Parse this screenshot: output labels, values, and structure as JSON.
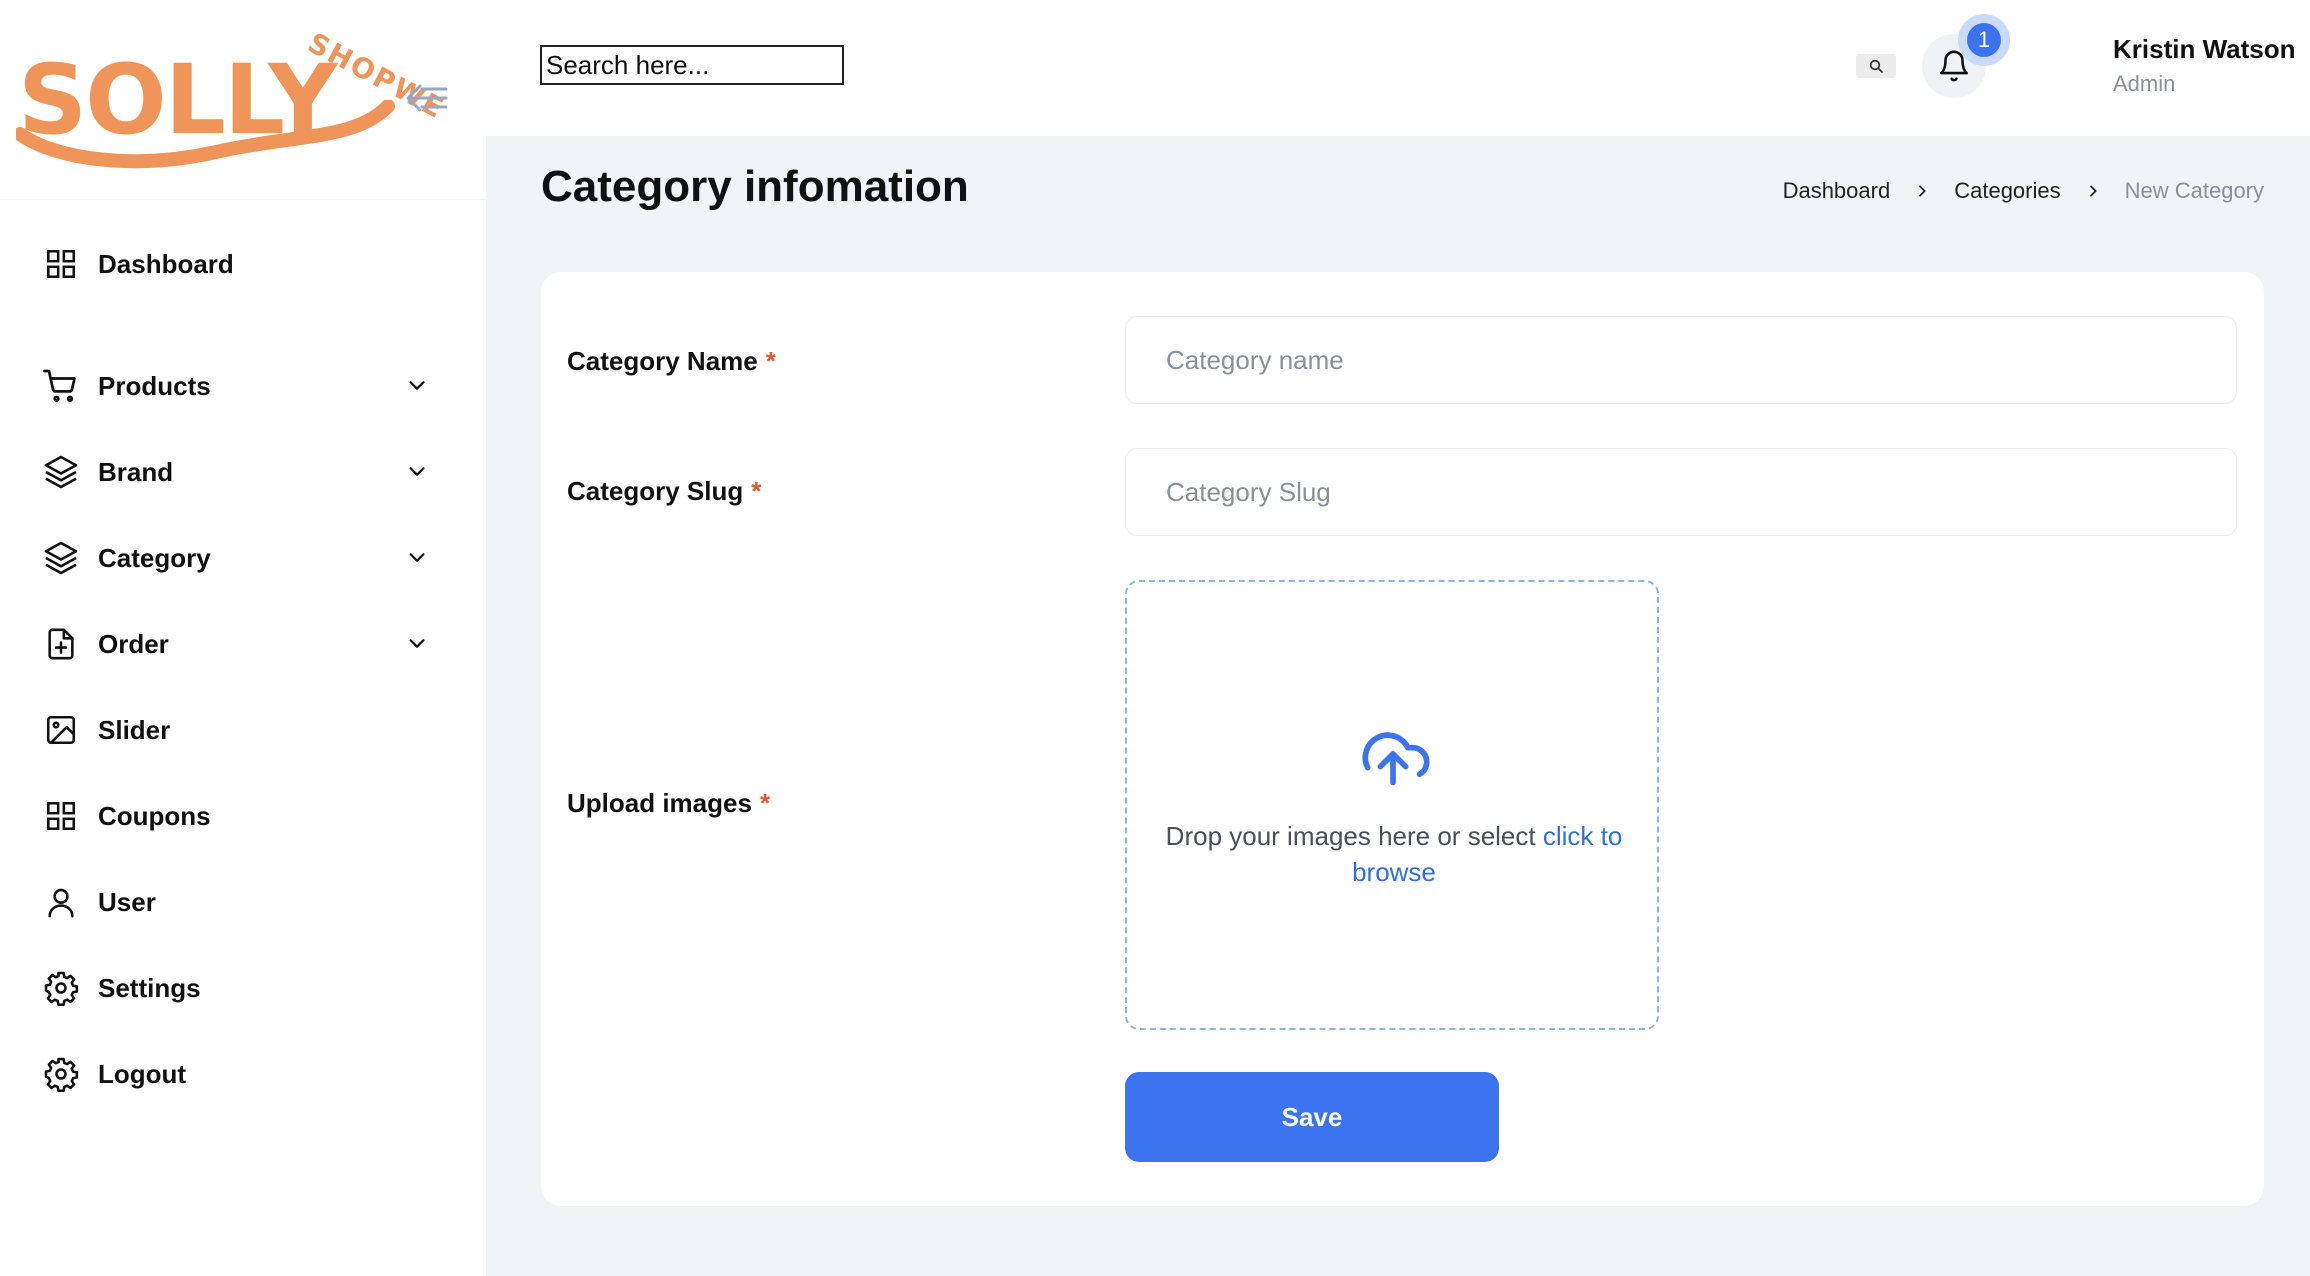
{
  "brand": {
    "name": "SOLLY",
    "tagline": "SHOPWE",
    "accent_color": "#f0955a"
  },
  "sidebar": {
    "collapse_icon": "arrow-collapse-left-icon",
    "items": [
      {
        "label": "Dashboard",
        "icon": "grid-icon",
        "has_submenu": false
      },
      {
        "label": "Products",
        "icon": "cart-icon",
        "has_submenu": true
      },
      {
        "label": "Brand",
        "icon": "layers-icon",
        "has_submenu": true
      },
      {
        "label": "Category",
        "icon": "layers-icon",
        "has_submenu": true
      },
      {
        "label": "Order",
        "icon": "file-plus-icon",
        "has_submenu": true
      },
      {
        "label": "Slider",
        "icon": "image-icon",
        "has_submenu": false
      },
      {
        "label": "Coupons",
        "icon": "grid-icon",
        "has_submenu": false
      },
      {
        "label": "User",
        "icon": "user-icon",
        "has_submenu": false
      },
      {
        "label": "Settings",
        "icon": "gear-icon",
        "has_submenu": false
      },
      {
        "label": "Logout",
        "icon": "gear-icon",
        "has_submenu": false
      }
    ]
  },
  "topbar": {
    "search": {
      "placeholder": "Search here...",
      "value": ""
    },
    "notifications": {
      "count": "1"
    },
    "user": {
      "name": "Kristin Watson",
      "role": "Admin"
    }
  },
  "page": {
    "title": "Category infomation",
    "breadcrumb": [
      "Dashboard",
      "Categories",
      "New Category"
    ]
  },
  "form": {
    "name": {
      "label": "Category Name",
      "required_mark": "*",
      "placeholder": "Category name",
      "value": ""
    },
    "slug": {
      "label": "Category Slug",
      "required_mark": "*",
      "placeholder": "Category Slug",
      "value": ""
    },
    "images": {
      "label": "Upload images",
      "required_mark": "*",
      "drop_text": "Drop your images here or select",
      "browse_link": "click to browse"
    },
    "save_label": "Save"
  },
  "colors": {
    "primary": "#3b74ee",
    "required": "#e8562a",
    "page_bg": "#f2f3f6"
  }
}
